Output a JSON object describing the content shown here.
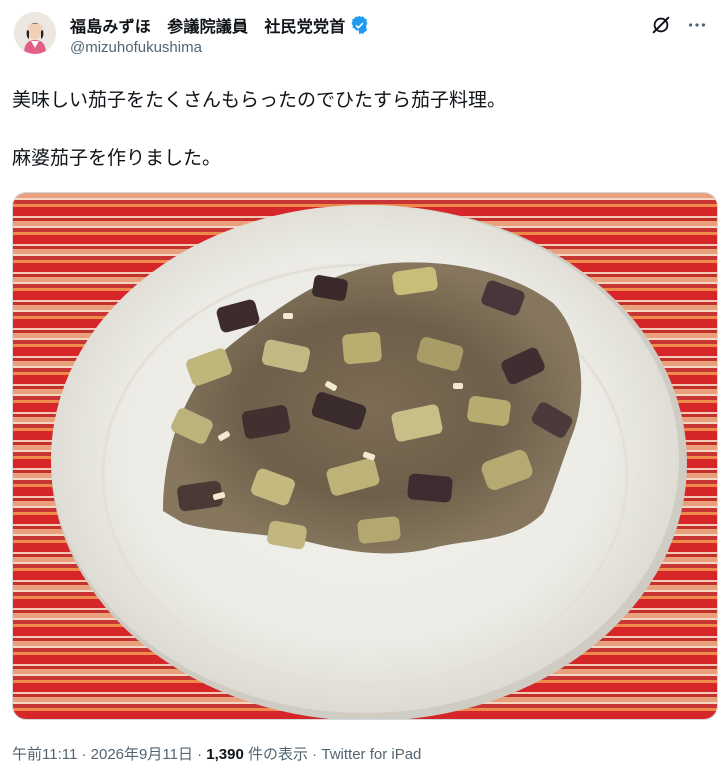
{
  "author": {
    "display_name": "福島みずほ　参議院議員　社民党党首",
    "handle": "@mizuhofukushima",
    "verified": true,
    "verified_color": "#1d9bf0"
  },
  "tweet": {
    "line1": "美味しい茄子をたくさんもらったのでひたすら茄子料理。",
    "line2": "麻婆茄子を作りました。"
  },
  "media": {
    "description_icon": "photo-mapo-eggplant"
  },
  "meta": {
    "time": "午前11:11",
    "separator": " · ",
    "date": "2026年9月11日",
    "views_count": "1,390",
    "views_label": " 件の表示",
    "source": "Twitter for iPad"
  },
  "icons": {
    "grok": "grok-icon",
    "more": "more-icon"
  }
}
